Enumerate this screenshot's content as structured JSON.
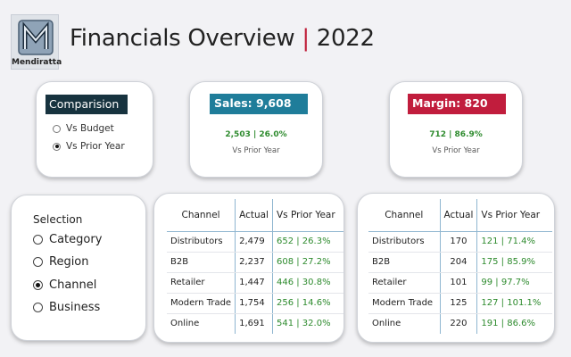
{
  "header": {
    "logo_text": "Mendiratta",
    "title": "Financials Overview",
    "separator": "|",
    "year": "2022"
  },
  "comparison": {
    "heading": "Comparision",
    "options": [
      {
        "label": "Vs Budget",
        "selected": false
      },
      {
        "label": "Vs Prior Year",
        "selected": true
      }
    ]
  },
  "sales_card": {
    "heading": "Sales: 9,608",
    "change": "2,503 |  26.0%",
    "subtitle": "Vs Prior Year",
    "color": "#1f7d9a"
  },
  "margin_card": {
    "heading": "Margin: 820",
    "change": "712 |  86.9%",
    "subtitle": "Vs Prior Year",
    "color": "#c11d3d"
  },
  "selection": {
    "heading": "Selection",
    "options": [
      {
        "label": "Category",
        "selected": false
      },
      {
        "label": "Region",
        "selected": false
      },
      {
        "label": "Channel",
        "selected": true
      },
      {
        "label": "Business",
        "selected": false
      }
    ]
  },
  "sales_table": {
    "columns": [
      "Channel",
      "Actual",
      "Vs Prior Year"
    ],
    "rows": [
      {
        "channel": "Distributors",
        "actual": "2,479",
        "vs": "652 | 26.3%"
      },
      {
        "channel": "B2B",
        "actual": "2,237",
        "vs": "608 | 27.2%"
      },
      {
        "channel": "Retailer",
        "actual": "1,447",
        "vs": "446 | 30.8%"
      },
      {
        "channel": "Modern Trade",
        "actual": "1,754",
        "vs": "256 | 14.6%"
      },
      {
        "channel": "Online",
        "actual": "1,691",
        "vs": "541 | 32.0%"
      }
    ]
  },
  "margin_table": {
    "columns": [
      "Channel",
      "Actual",
      "Vs Prior Year"
    ],
    "rows": [
      {
        "channel": "Distributors",
        "actual": "170",
        "vs": "121 | 71.4%"
      },
      {
        "channel": "B2B",
        "actual": "204",
        "vs": "175 | 85.9%"
      },
      {
        "channel": "Retailer",
        "actual": "101",
        "vs": "99 | 97.7%"
      },
      {
        "channel": "Modern Trade",
        "actual": "125",
        "vs": "127 | 101.1%"
      },
      {
        "channel": "Online",
        "actual": "220",
        "vs": "191 | 86.6%"
      }
    ]
  },
  "colors": {
    "positive": "#2e8b2e",
    "accent_red": "#c0213c",
    "dark_header": "#17333f"
  }
}
